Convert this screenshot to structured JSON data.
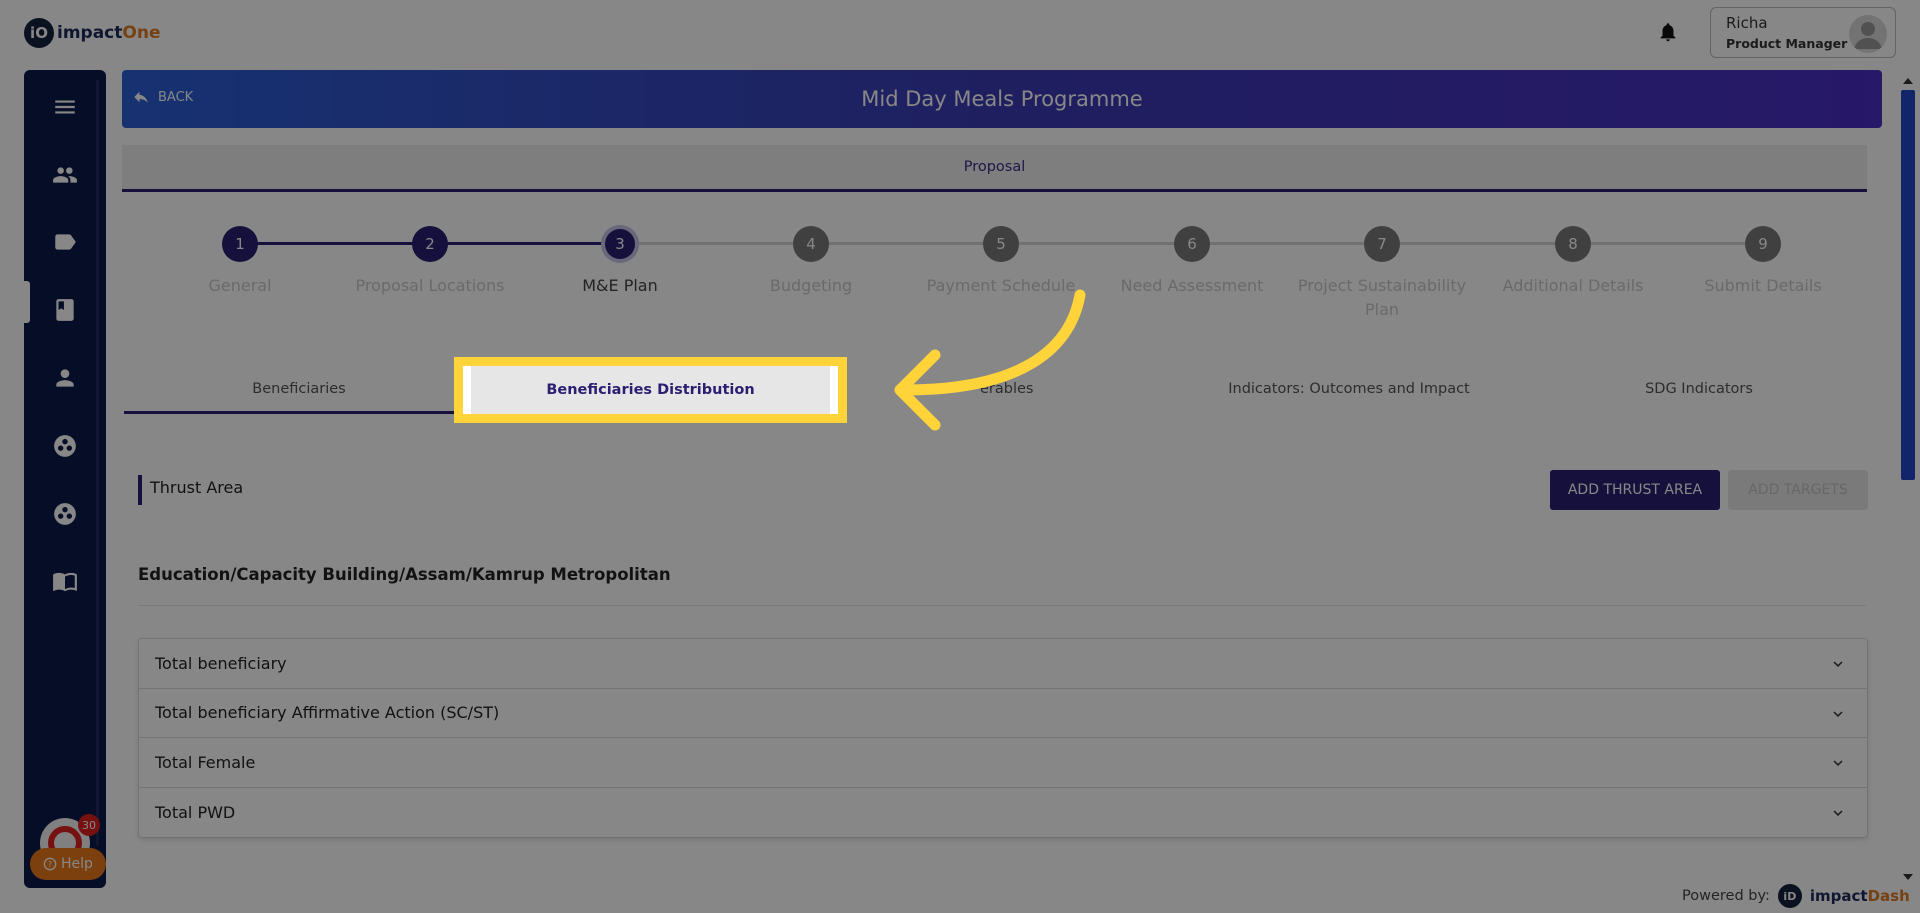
{
  "header": {
    "logo_mark": "iO",
    "logo_text_main": "impact",
    "logo_text_accent": "One",
    "user_name": "Richa",
    "user_role": "Product Manager"
  },
  "sidebar": {
    "items": [
      {
        "icon": "menu-icon"
      },
      {
        "icon": "users-icon"
      },
      {
        "icon": "label-icon"
      },
      {
        "icon": "book-icon"
      },
      {
        "icon": "person-icon"
      },
      {
        "icon": "workspaces-icon"
      },
      {
        "icon": "hub-icon"
      },
      {
        "icon": "open-book-icon"
      }
    ],
    "notification_count": "30",
    "help_label": "Help"
  },
  "title_bar": {
    "back_label": "BACK",
    "title": "Mid Day Meals Programme"
  },
  "proposal_tab": "Proposal",
  "stepper": {
    "steps": [
      {
        "number": "1",
        "label": "General",
        "state": "done"
      },
      {
        "number": "2",
        "label": "Proposal Locations",
        "state": "done"
      },
      {
        "number": "3",
        "label": "M&E Plan",
        "state": "current"
      },
      {
        "number": "4",
        "label": "Budgeting",
        "state": "todo"
      },
      {
        "number": "5",
        "label": "Payment Schedule",
        "state": "todo"
      },
      {
        "number": "6",
        "label": "Need Assessment",
        "state": "todo"
      },
      {
        "number": "7",
        "label": "Project Sustainability Plan",
        "state": "todo"
      },
      {
        "number": "8",
        "label": "Additional Details",
        "state": "todo"
      },
      {
        "number": "9",
        "label": "Submit Details",
        "state": "todo"
      }
    ]
  },
  "subtabs": {
    "items": [
      {
        "label": "Beneficiaries"
      },
      {
        "label": "Beneficiaries Distribution"
      },
      {
        "label": "Deliverables"
      },
      {
        "label": "Indicators: Outcomes and Impact"
      },
      {
        "label": "SDG Indicators"
      }
    ],
    "visible_partial": "erables"
  },
  "section": {
    "title": "Thrust Area",
    "add_thrust_label": "ADD THRUST AREA",
    "add_targets_label": "ADD TARGETS"
  },
  "location": "Education/Capacity Building/Assam/Kamrup Metropolitan",
  "accordion": {
    "rows": [
      {
        "label": "Total beneficiary"
      },
      {
        "label": "Total beneficiary Affirmative Action (SC/ST)"
      },
      {
        "label": "Total Female"
      },
      {
        "label": "Total PWD"
      }
    ]
  },
  "footer": {
    "powered_by": "Powered by:",
    "logo_mark": "iD",
    "brand_main": "impact",
    "brand_accent": "Dash"
  },
  "colors": {
    "brand_dark": "#2b1f72",
    "highlight": "#ffd43b",
    "help_orange": "#ea7a1c"
  }
}
